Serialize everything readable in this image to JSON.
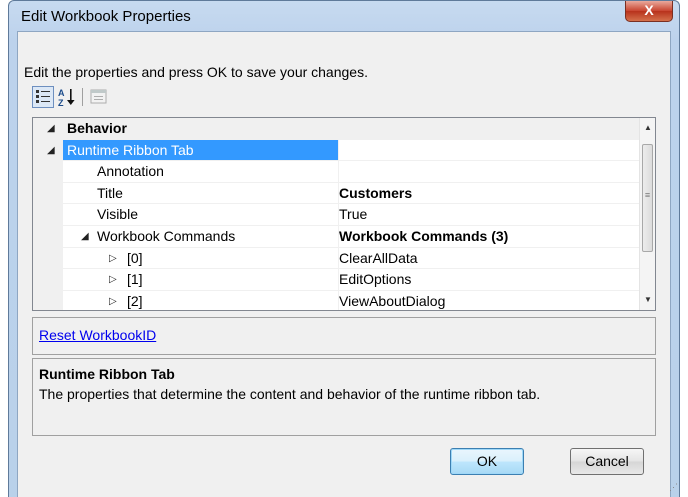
{
  "window": {
    "title": "Edit Workbook Properties",
    "close_glyph": "X"
  },
  "instructions": "Edit the properties and press OK to save your changes.",
  "toolbar": {
    "categorized_icon": "categorized-icon",
    "alphabetical_icon": "sort-alphabetical-icon",
    "property_pages_icon": "property-pages-icon"
  },
  "grid": {
    "rows": [
      {
        "kind": "category",
        "name": "Behavior",
        "value": "",
        "expand": "◢"
      },
      {
        "kind": "selected",
        "name": "Runtime Ribbon Tab",
        "value": "",
        "expand": "◢"
      },
      {
        "kind": "prop",
        "name": "Annotation",
        "value": ""
      },
      {
        "kind": "prop",
        "name": "Title",
        "value": "Customers",
        "value_bold": true
      },
      {
        "kind": "prop",
        "name": "Visible",
        "value": "True"
      },
      {
        "kind": "prop",
        "name": "Workbook Commands",
        "value": "Workbook Commands (3)",
        "value_bold": true,
        "expand": "◢"
      },
      {
        "kind": "prop",
        "name": "[0]",
        "value": "ClearAllData",
        "expand": "▷"
      },
      {
        "kind": "prop",
        "name": "[1]",
        "value": "EditOptions",
        "expand": "▷"
      },
      {
        "kind": "prop",
        "name": "[2]",
        "value": "ViewAboutDialog",
        "expand": "▷"
      }
    ]
  },
  "commands": {
    "reset_link": "Reset WorkbookID"
  },
  "description": {
    "title": "Runtime Ribbon Tab",
    "text": "The properties that determine the content and behavior of the runtime ribbon tab."
  },
  "buttons": {
    "ok": "OK",
    "cancel": "Cancel"
  },
  "colors": {
    "selection": "#3399ff",
    "link": "#0000ee",
    "close": "#c8442f"
  }
}
